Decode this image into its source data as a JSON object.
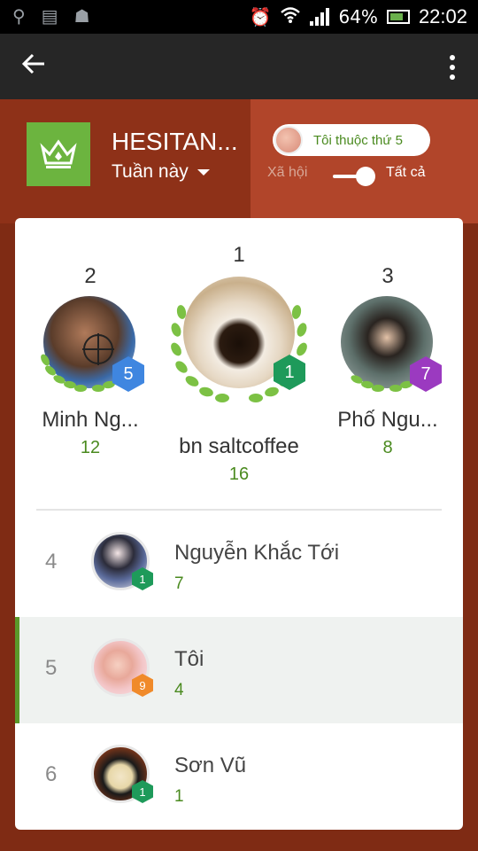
{
  "status_bar": {
    "battery": "64%",
    "time": "22:02",
    "icons": [
      "usb-icon",
      "sim-icon",
      "android-icon",
      "alarm-icon",
      "wifi-icon",
      "signal-icon",
      "battery-icon"
    ]
  },
  "app_bar": {
    "back_icon": "arrow-back-icon",
    "menu_icon": "overflow-menu-icon"
  },
  "header": {
    "title": "HESITAN...",
    "period": "Tuần này",
    "player_rank_pill": "Tôi thuộc thứ 5",
    "toggle_left": "Xã hội",
    "toggle_right": "Tất cả",
    "toggle_state": "Tất cả",
    "accent_color": "#6cb43f"
  },
  "podium": [
    {
      "rank": "2",
      "name": "Minh Ng...",
      "score": "12",
      "level": "5",
      "level_color": "#3f86e0"
    },
    {
      "rank": "1",
      "name": "bn saltcoffee",
      "score": "16",
      "level": "1",
      "level_color": "#1e9a5a"
    },
    {
      "rank": "3",
      "name": "Phố Ngu...",
      "score": "8",
      "level": "7",
      "level_color": "#9b3ac0"
    }
  ],
  "list": [
    {
      "rank": "4",
      "name": "Nguyễn Khắc Tới",
      "score": "7",
      "level": "1",
      "level_color": "#1e9a5a",
      "highlight": false
    },
    {
      "rank": "5",
      "name": "Tôi",
      "score": "4",
      "level": "9",
      "level_color": "#f08a2a",
      "highlight": true
    },
    {
      "rank": "6",
      "name": "Sơn Vũ",
      "score": "1",
      "level": "1",
      "level_color": "#1e9a5a",
      "highlight": false
    }
  ]
}
